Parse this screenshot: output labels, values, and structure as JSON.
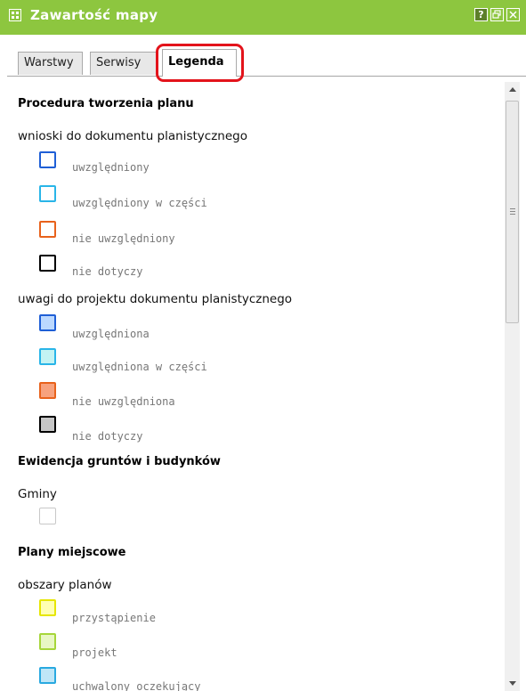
{
  "window": {
    "title": "Zawartość mapy",
    "icon": "grid-icon",
    "buttons": {
      "help": "?",
      "restore": "restore-icon",
      "close": "close-icon"
    },
    "accent": "#8dc63f"
  },
  "tabs": [
    {
      "label": "Warstwy",
      "active": false
    },
    {
      "label": "Serwisy",
      "active": false
    },
    {
      "label": "Legenda",
      "active": true
    }
  ],
  "legend": {
    "sections": [
      {
        "heading": "Procedura tworzenia planu",
        "groups": [
          {
            "title": "wnioski do dokumentu planistycznego",
            "items": [
              {
                "label": "uwzględniony",
                "border": "#1f5fd6",
                "fill": "#ffffff"
              },
              {
                "label": "uwzględniony w części",
                "border": "#29b5e8",
                "fill": "#ffffff"
              },
              {
                "label": "nie uwzględniony",
                "border": "#e8621c",
                "fill": "#ffffff"
              },
              {
                "label": "nie dotyczy",
                "border": "#000000",
                "fill": "#ffffff"
              }
            ]
          },
          {
            "title": "uwagi do projektu dokumentu planistycznego",
            "items": [
              {
                "label": "uwzględniona",
                "border": "#1f5fd6",
                "fill": "#bcd9ff"
              },
              {
                "label": "uwzględniona w części",
                "border": "#29b5e8",
                "fill": "#c4f3f3"
              },
              {
                "label": "nie uwzględniona",
                "border": "#e8621c",
                "fill": "#f7a27e"
              },
              {
                "label": "nie dotyczy",
                "border": "#000000",
                "fill": "#c6c6c6"
              }
            ]
          }
        ]
      },
      {
        "heading": "Ewidencja gruntów i budynków",
        "groups": [
          {
            "title": "Gminy",
            "items": [
              {
                "label": "",
                "border": "#c8c8c8",
                "fill": "#ffffff"
              }
            ]
          }
        ]
      },
      {
        "heading": "Plany miejscowe",
        "groups": [
          {
            "title": "obszary planów",
            "items": [
              {
                "label": "przystąpienie",
                "border": "#e6e600",
                "fill": "#ffffb3"
              },
              {
                "label": "projekt",
                "border": "#a6d63a",
                "fill": "#e8f7c4"
              },
              {
                "label": "uchwalony oczekujący",
                "border": "#29a9e0",
                "fill": "#bfe6f7"
              }
            ]
          }
        ]
      }
    ]
  }
}
